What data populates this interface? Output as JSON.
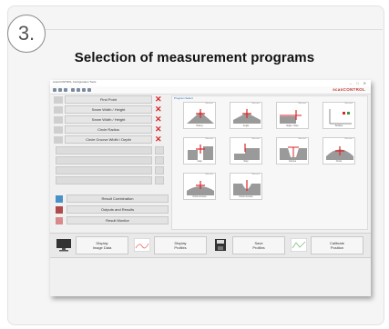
{
  "step": {
    "number": "3."
  },
  "heading": "Selection of measurement programs",
  "app": {
    "title": "scanCONTROL Configuration Tools",
    "window_controls": "–  □  ✕",
    "brand": "scanCONTROL",
    "panel_label": "Program Select"
  },
  "programs": [
    {
      "label": "Find Point",
      "icon": "find-point-icon"
    },
    {
      "label": "Seam Width / Height",
      "icon": "seam-width-icon"
    },
    {
      "label": "Seam Width / Height",
      "icon": "seam-width-icon"
    },
    {
      "label": "Circle Radius",
      "icon": "circle-radius-icon"
    },
    {
      "label": "Circle Groove Width / Depth",
      "icon": "circle-groove-icon"
    }
  ],
  "empty_slots": 4,
  "actions": [
    {
      "label": "Result Combination",
      "icon": "result-combination-icon"
    },
    {
      "label": "Outputs and Results",
      "icon": "outputs-icon"
    },
    {
      "label": "Result Monitor",
      "icon": "result-monitor-icon"
    }
  ],
  "tiles": [
    {
      "label": "Rising",
      "tag": "Measure"
    },
    {
      "label": "Angle",
      "tag": "Measure"
    },
    {
      "label": "Edge / Step",
      "tag": "Measure"
    },
    {
      "label": "Surface",
      "tag": "Measure"
    },
    {
      "label": "Gap",
      "tag": "Measure"
    },
    {
      "label": "Step",
      "tag": "Measure"
    },
    {
      "label": "Groove",
      "tag": "Measure"
    },
    {
      "label": "Circle",
      "tag": "Measure"
    },
    {
      "label": "Circle Groove",
      "tag": "Measure"
    },
    {
      "label": "Circle Groove",
      "tag": "Measure"
    }
  ],
  "bottom": [
    {
      "line1": "Display",
      "line2": "Image Data",
      "icon": "monitor-icon"
    },
    {
      "line1": "Display",
      "line2": "Profiles",
      "icon": "profile-chart-icon"
    },
    {
      "line1": "Save",
      "line2": "Profiles",
      "icon": "save-icon"
    },
    {
      "line1": "Calibrate",
      "line2": "Position",
      "icon": "calibrate-icon"
    }
  ],
  "colors": {
    "accent_red": "#d9262a",
    "link_blue": "#2a6ab0"
  }
}
